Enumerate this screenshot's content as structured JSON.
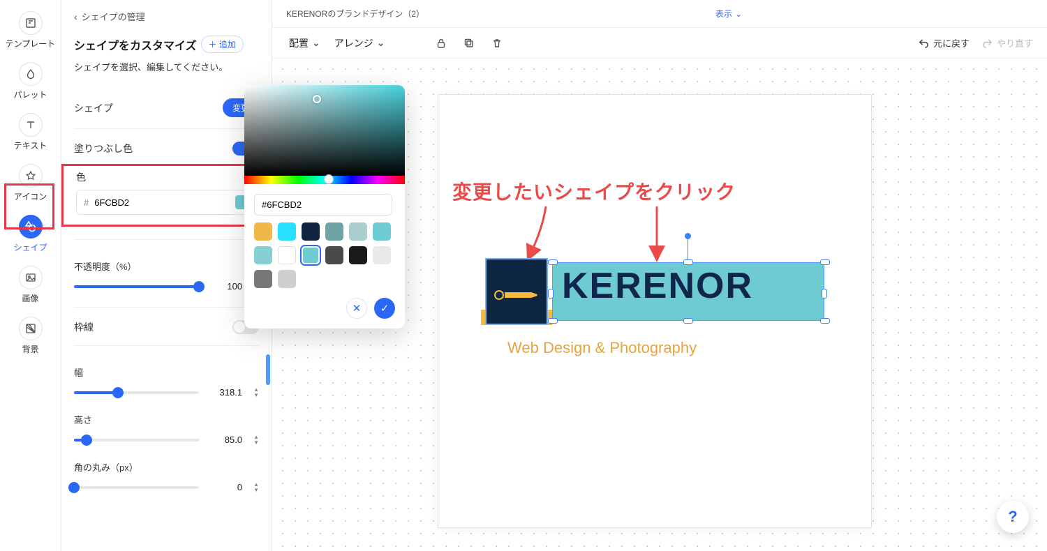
{
  "rail": {
    "items": [
      {
        "label": "テンプレート"
      },
      {
        "label": "パレット"
      },
      {
        "label": "テキスト"
      },
      {
        "label": "アイコン"
      },
      {
        "label": "シェイプ"
      },
      {
        "label": "画像"
      },
      {
        "label": "背景"
      }
    ]
  },
  "panel": {
    "back_label": "シェイプの管理",
    "title": "シェイプをカスタマイズ",
    "add_label": "＋ 追加",
    "subtitle": "シェイプを選択、編集してください。",
    "shape_label": "シェイプ",
    "change_btn": "変更",
    "fill_label": "塗りつぶし色",
    "color_label": "色",
    "color_value": "6FCBD2",
    "opacity_label": "不透明度（%）",
    "opacity_value": "100",
    "border_label": "枠線",
    "width_label": "幅",
    "width_value": "318.1",
    "height_label": "高さ",
    "height_value": "85.0",
    "radius_label": "角の丸み（px）",
    "radius_value": "0"
  },
  "picker": {
    "hex": "#6FCBD2",
    "swatches": [
      "#f0b84a",
      "#26e0ff",
      "#0f2642",
      "#6fa3a5",
      "#a9cecd",
      "#6fcbd2",
      "#88cfd4",
      "#ffffff",
      "#6fcbd2",
      "#4a4a4a",
      "#1a1a1a",
      "#e9e9e9",
      "#777777",
      "#cfcfcf"
    ],
    "selected_index": 8
  },
  "top": {
    "doc_title": "KERENORのブランドデザイン（2）",
    "view_label": "表示",
    "place_label": "配置",
    "arrange_label": "アレンジ",
    "undo_label": "元に戻す",
    "redo_label": "やり直す"
  },
  "canvas": {
    "annotation": "変更したいシェイプをクリック",
    "logo_text": "KERENOR",
    "tagline": "Web Design & Photography"
  },
  "help_label": "?"
}
